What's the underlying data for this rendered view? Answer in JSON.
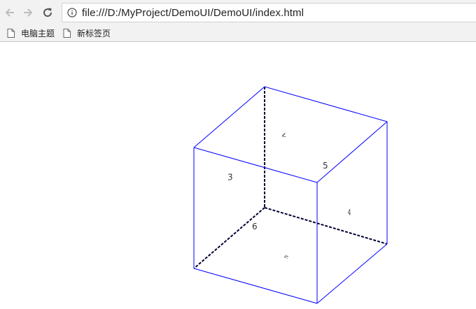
{
  "toolbar": {
    "back_icon": "arrow-left-icon",
    "forward_icon": "arrow-right-icon",
    "reload_icon": "reload-icon",
    "info_icon": "info-icon",
    "url": "file:///D:/MyProject/DemoUI/DemoUI/index.html"
  },
  "bookmarks": [
    {
      "label": "电脑主题",
      "icon": "page-icon"
    },
    {
      "label": "新标签页",
      "icon": "page-icon"
    }
  ],
  "cube": {
    "edge_color": "#0000ff",
    "hidden_edge_color": "#000033",
    "faces": [
      {
        "label": "3"
      },
      {
        "label": "5"
      },
      {
        "label": "6"
      },
      {
        "label": "7"
      },
      {
        "label": "4"
      },
      {
        "label": "2"
      }
    ]
  }
}
